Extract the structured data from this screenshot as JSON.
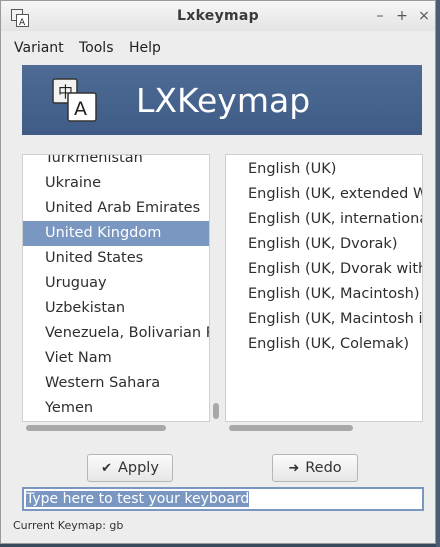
{
  "window": {
    "title": "Lxkeymap",
    "min_icon": "minimize-icon",
    "max_icon": "maximize-icon",
    "close_icon": "close-icon"
  },
  "menu": {
    "items": [
      "Variant",
      "Tools",
      "Help"
    ]
  },
  "banner": {
    "title": "LXKeymap",
    "icon": "keyboard-layout-icon"
  },
  "countries": {
    "items": [
      "Turkmenistan",
      "Ukraine",
      "United Arab Emirates",
      "United Kingdom",
      "United States",
      "Uruguay",
      "Uzbekistan",
      "Venezuela, Bolivarian Rep",
      "Viet Nam",
      "Western Sahara",
      "Yemen"
    ],
    "selected": "United Kingdom"
  },
  "variants": {
    "items": [
      "English (UK)",
      "English (UK, extended WinK",
      "English (UK, international w",
      "English (UK, Dvorak)",
      "English (UK, Dvorak with UK",
      "English (UK, Macintosh)",
      "English (UK, Macintosh inte",
      "English (UK, Colemak)"
    ]
  },
  "buttons": {
    "apply": "Apply",
    "apply_icon": "check-icon",
    "redo": "Redo",
    "redo_icon": "redo-arrow-icon"
  },
  "test_field": {
    "value": "Type here to test your keyboard"
  },
  "status": {
    "text": "Current Keymap: gb"
  }
}
